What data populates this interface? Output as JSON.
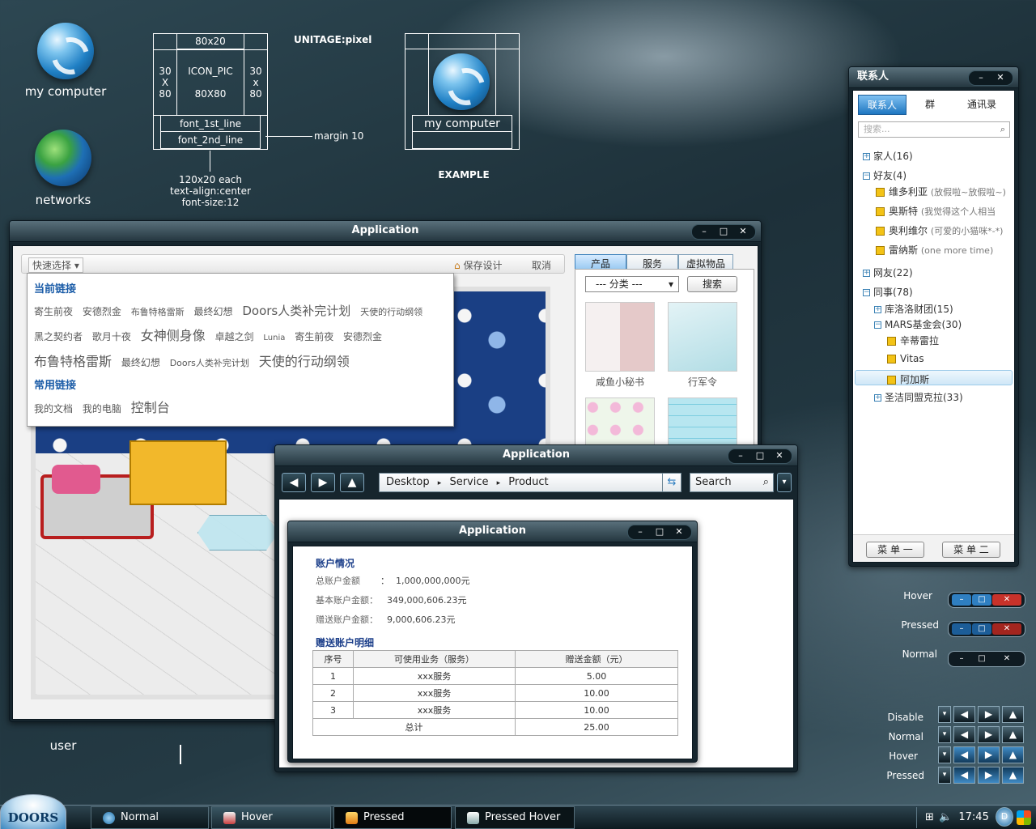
{
  "desktop": {
    "icons": [
      {
        "label": "my computer"
      },
      {
        "label": "networks"
      },
      {
        "label": "user"
      }
    ]
  },
  "spec": {
    "top": "80x20",
    "left": "30\nX\n80",
    "center": "ICON_PIC\n\n80X80",
    "right": "30\nx\n80",
    "line1": "font_1st_line",
    "line2": "font_2nd_line",
    "margin": "margin 10",
    "unit": "UNITAGE:pixel",
    "note": "120x20 each\ntext-align:center\nfont-size:12",
    "example_label": "my computer",
    "example_caption": "EXAMPLE"
  },
  "app1": {
    "title": "Application",
    "quick_select": "快速选择",
    "save_design": "保存设计",
    "cancel": "取消",
    "recent_heading": "当前链接",
    "recent_row1": [
      "寄生前夜",
      "安德烈金",
      "布鲁特格雷斯",
      "最终幻想",
      "Doors人类补完计划",
      "天使的行动纲领"
    ],
    "recent_row2": [
      "黑之契约者",
      "歌月十夜",
      "女神侧身像",
      "卓越之剑",
      "Lunia",
      "寄生前夜",
      "安德烈金"
    ],
    "recent_row3": [
      "布鲁特格雷斯",
      "最终幻想",
      "Doors人类补完计划",
      "天使的行动纲领"
    ],
    "common_heading": "常用链接",
    "common_row": [
      "我的文档",
      "我的电脑",
      "控制台"
    ],
    "tabs": [
      "产品",
      "服务",
      "虚拟物品"
    ],
    "category": "--- 分类 ---",
    "search": "搜索",
    "items": [
      "咸鱼小秘书",
      "行军令"
    ]
  },
  "app2": {
    "title": "Application",
    "breadcrumb": [
      "Desktop",
      "Service",
      "Product"
    ],
    "search_placeholder": "Search"
  },
  "app3": {
    "title": "Application",
    "account_heading": "账户情况",
    "total_label": "总账户金额",
    "total_value": "1,000,000,000元",
    "basic_label": "基本账户金额：",
    "basic_value": "349,000,606.23元",
    "gift_label": "赠送账户金额：",
    "gift_value": "9,000,606.23元",
    "detail_heading": "赠送账户明细",
    "table": {
      "headers": [
        "序号",
        "可使用业务（服务）",
        "赠送金额（元）"
      ],
      "rows": [
        [
          "1",
          "xxx服务",
          "5.00"
        ],
        [
          "2",
          "xxx服务",
          "10.00"
        ],
        [
          "3",
          "xxx服务",
          "10.00"
        ]
      ],
      "total_label": "总计",
      "total_value": "25.00"
    }
  },
  "contacts": {
    "title": "联系人",
    "tabs": [
      "联系人",
      "群",
      "通讯录"
    ],
    "search_placeholder": "搜索...",
    "family": "家人(16)",
    "friends": "好友(4)",
    "friend_list": [
      {
        "name": "维多利亚",
        "sub": "(放假啦~放假啦~)"
      },
      {
        "name": "奥斯特",
        "sub": "(我觉得这个人相当"
      },
      {
        "name": "奥利维尔",
        "sub": "(可爱的小猫咪*-*)"
      },
      {
        "name": "雷纳斯",
        "sub": "(one more time)"
      }
    ],
    "netfriends": "网友(22)",
    "colleagues": "同事(78)",
    "group1": "库洛洛财团(15)",
    "group2": "MARS基金会(30)",
    "group2_members": [
      "辛蒂雷拉",
      "Vitas",
      "阿加斯"
    ],
    "group3": "圣洁同盟克拉(33)",
    "menu1": "菜 单 一",
    "menu2": "菜 单 二"
  },
  "samples": {
    "window_states": [
      "Hover",
      "Pressed",
      "Normal"
    ],
    "nav_states": [
      "Disable",
      "Normal",
      "Hover",
      "Pressed"
    ]
  },
  "taskbar": {
    "start": "DOORS",
    "buttons": [
      "Normal",
      "Hover",
      "Pressed",
      "Pressed Hover"
    ],
    "clock": "17:45"
  },
  "colors": {
    "accent": "#1c5da8",
    "close_red": "#c8322a",
    "min_blue": "#2f7fc1"
  }
}
